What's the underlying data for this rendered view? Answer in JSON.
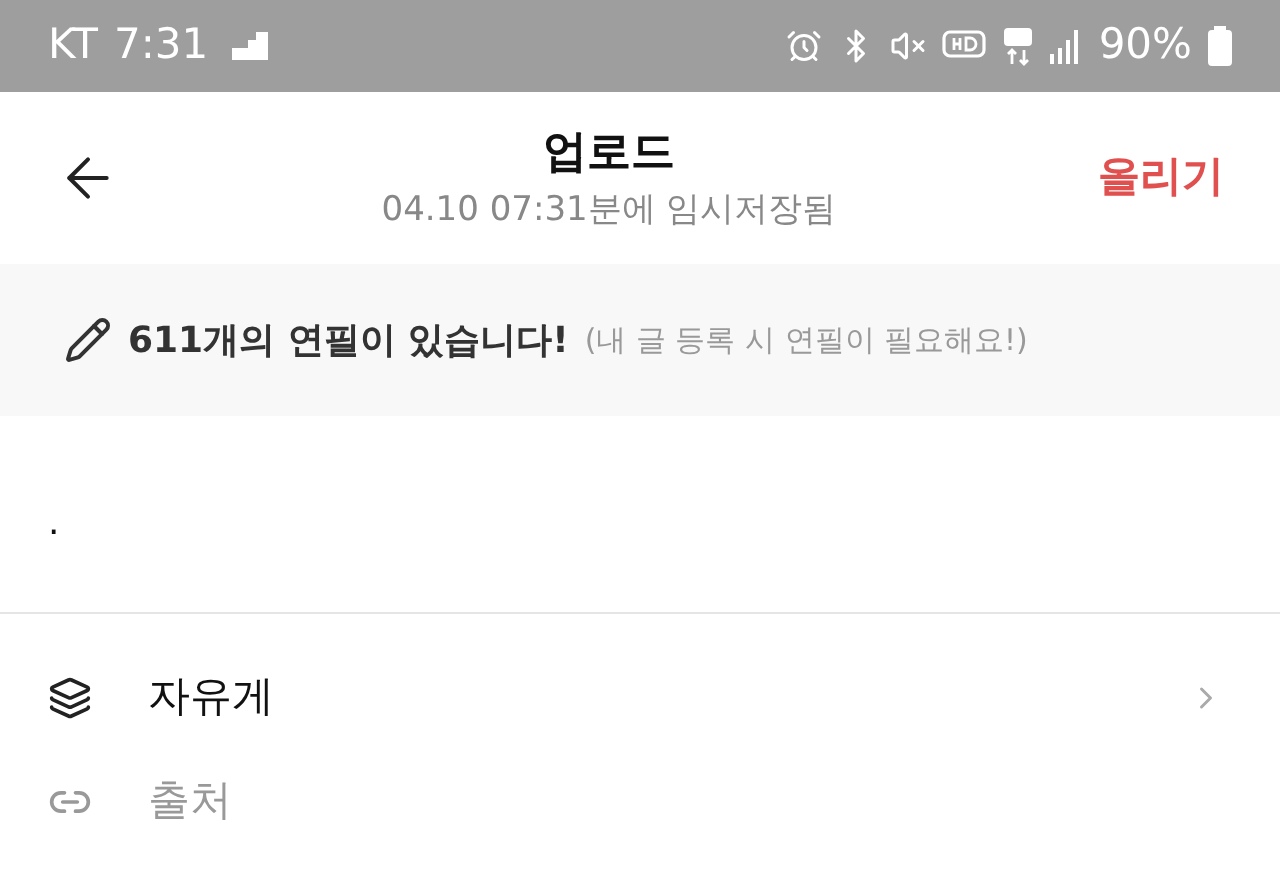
{
  "status_bar": {
    "carrier": "KT",
    "time": "7:31",
    "battery": "90%"
  },
  "header": {
    "title": "업로드",
    "subtitle": "04.10 07:31분에 임시저장됨",
    "action": "올리기"
  },
  "banner": {
    "message": "611개의 연필이 있습니다!",
    "note": "(내 글 등록 시 연필이 필요해요!)"
  },
  "editor": {
    "body": "."
  },
  "options": [
    {
      "kind": "board",
      "label": "자유게"
    },
    {
      "kind": "source",
      "label": "출처"
    }
  ]
}
